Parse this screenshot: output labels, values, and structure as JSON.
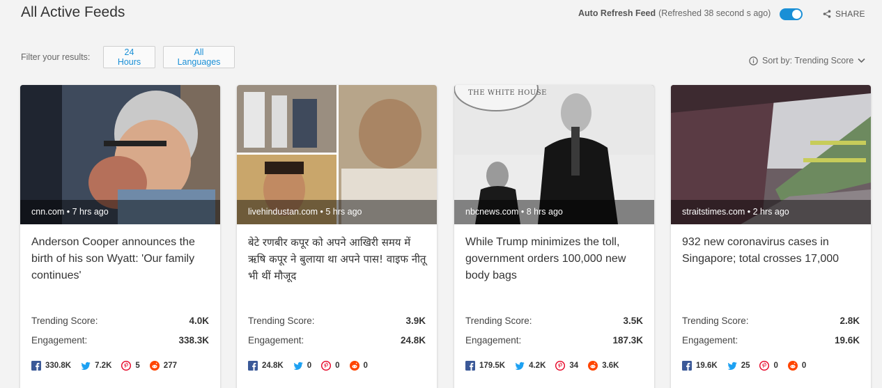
{
  "header": {
    "title": "All Active Feeds",
    "auto_refresh_label": "Auto Refresh Feed",
    "refreshed_text": "(Refreshed 38 second s ago)",
    "auto_refresh_on": true,
    "share_label": "SHARE"
  },
  "filters": {
    "label": "Filter your results:",
    "time_button": "24 Hours",
    "language_button": "All Languages"
  },
  "sort": {
    "label": "Sort by: Trending Score"
  },
  "colors": {
    "accent": "#1a8fd6",
    "facebook": "#3b5998",
    "twitter": "#1da1f2",
    "pinterest": "#e60023",
    "reddit": "#ff4500"
  },
  "cards": [
    {
      "source": "cnn.com • 7 hrs ago",
      "headline": "Anderson Cooper announces the birth of his son Wyatt: 'Our family continues'",
      "trending_label": "Trending Score:",
      "trending": "4.0K",
      "engagement_label": "Engagement:",
      "engagement": "338.3K",
      "facebook": "330.8K",
      "twitter": "7.2K",
      "pinterest": "5",
      "reddit": "277"
    },
    {
      "source": "livehindustan.com • 5 hrs ago",
      "headline": "बेटे रणबीर कपूर को अपने आखिरी समय में ऋषि कपूर ने बुलाया था अपने पास! वाइफ नीतू भी थीं मौजूद",
      "trending_label": "Trending Score:",
      "trending": "3.9K",
      "engagement_label": "Engagement:",
      "engagement": "24.8K",
      "facebook": "24.8K",
      "twitter": "0",
      "pinterest": "0",
      "reddit": "0"
    },
    {
      "source": "nbcnews.com • 8 hrs ago",
      "headline": "While Trump minimizes the toll, government orders 100,000 new body bags",
      "trending_label": "Trending Score:",
      "trending": "3.5K",
      "engagement_label": "Engagement:",
      "engagement": "187.3K",
      "facebook": "179.5K",
      "twitter": "4.2K",
      "pinterest": "34",
      "reddit": "3.6K",
      "image_caption": "THE WHITE HOUSE"
    },
    {
      "source": "straitstimes.com • 2 hrs ago",
      "headline": "932 new coronavirus cases in Singapore; total crosses 17,000",
      "trending_label": "Trending Score:",
      "trending": "2.8K",
      "engagement_label": "Engagement:",
      "engagement": "19.6K",
      "facebook": "19.6K",
      "twitter": "25",
      "pinterest": "0",
      "reddit": "0"
    }
  ]
}
